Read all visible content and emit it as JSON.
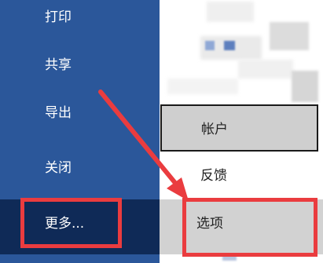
{
  "sidebar": {
    "items": [
      {
        "label": "打印"
      },
      {
        "label": "共享"
      },
      {
        "label": "导出"
      },
      {
        "label": "关闭"
      },
      {
        "label": "更多..."
      }
    ]
  },
  "submenu": {
    "account_label": "帐户",
    "feedback_label": "反馈",
    "options_label": "选项"
  },
  "colors": {
    "sidebar_bg": "#2b579a",
    "sidebar_active": "#0f2a57",
    "highlight": "#ea3c3f"
  }
}
